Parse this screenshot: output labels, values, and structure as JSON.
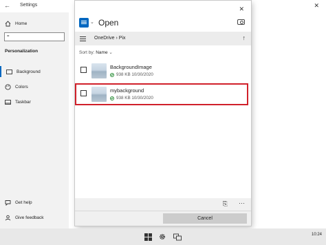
{
  "settings": {
    "title": "Settings",
    "back_glyph": "←",
    "close_glyph": "✕",
    "home_label": "Home",
    "search_value": "=",
    "section_heading": "Personalization",
    "nav_items": [
      {
        "label": "Background",
        "icon": "image-icon"
      },
      {
        "label": "Colors",
        "icon": "palette-icon"
      },
      {
        "label": "Taskbar",
        "icon": "taskbar-icon"
      }
    ],
    "help_label": "Get help",
    "feedback_label": "Give feedback"
  },
  "dialog": {
    "title": "Open",
    "close_glyph": "✕",
    "app_chevron": "⌄",
    "breadcrumb": "OneDrive  ›  Pix",
    "up_glyph": "↑",
    "sort_label": "Sort by:",
    "sort_value": "Name",
    "sort_chevron": "⌄",
    "files": [
      {
        "name": "BackgroundImage",
        "size": "938 KB",
        "date": "10/30/2020",
        "selected": false
      },
      {
        "name": "mybackground",
        "size": "938 KB",
        "date": "10/30/2020",
        "selected": true
      }
    ],
    "more_glyph": "···",
    "open_file_glyph": "⎘",
    "cancel_label": "Cancel"
  },
  "taskbar": {
    "clock": "10:24"
  },
  "colors": {
    "accent": "#0067c0",
    "highlight_border": "#d0202a",
    "sync_ok": "#2d8f3a"
  }
}
